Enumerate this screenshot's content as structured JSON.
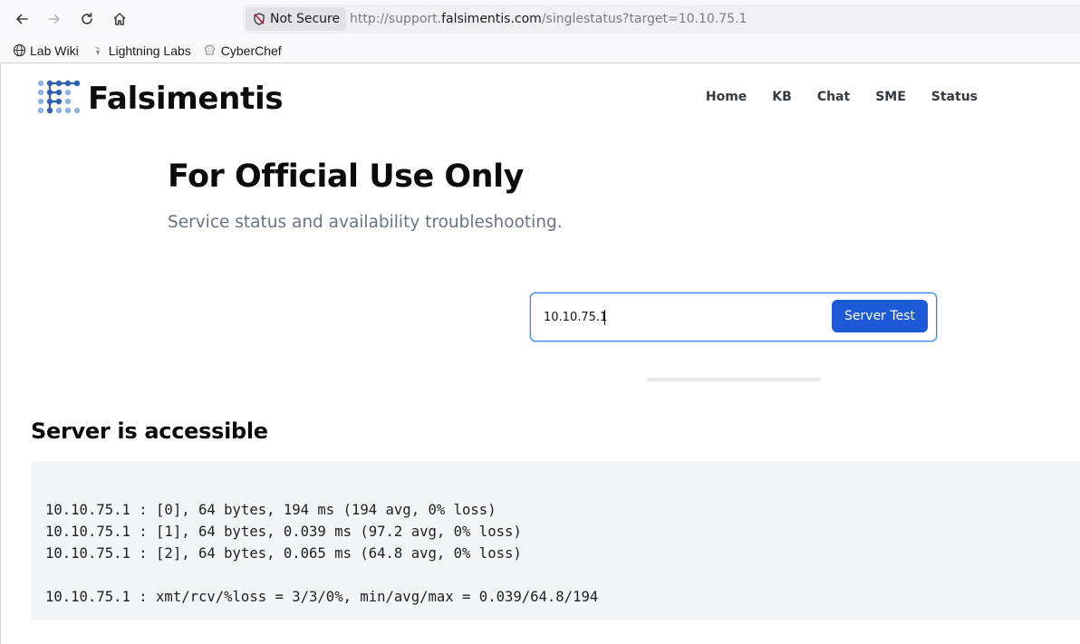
{
  "browser": {
    "security_label": "Not Secure",
    "url_prefix": "http://support.",
    "url_domain": "falsimentis.com",
    "url_path": "/singlestatus?target=10.10.75.1",
    "bookmarks": [
      {
        "label": "Lab Wiki",
        "icon": "globe-icon"
      },
      {
        "label": "Lightning Labs",
        "icon": "lightning-labs-icon"
      },
      {
        "label": "CyberChef",
        "icon": "chef-hat-icon"
      }
    ]
  },
  "site": {
    "brand": "Falsimentis",
    "nav": [
      "Home",
      "KB",
      "Chat",
      "SME",
      "Status"
    ]
  },
  "hero": {
    "title": "For Official Use Only",
    "subtitle": "Service status and availability troubleshooting."
  },
  "search": {
    "value": "10.10.75.1",
    "button_label": "Server Test"
  },
  "result": {
    "title": "Server is accessible",
    "lines": [
      "10.10.75.1 : [0], 64 bytes, 194 ms (194 avg, 0% loss)",
      "10.10.75.1 : [1], 64 bytes, 0.039 ms (97.2 avg, 0% loss)",
      "10.10.75.1 : [2], 64 bytes, 0.065 ms (64.8 avg, 0% loss)"
    ],
    "summary": "10.10.75.1 : xmt/rcv/%loss = 3/3/0%, min/avg/max = 0.039/64.8/194"
  },
  "colors": {
    "accent": "#1d5ad8",
    "focus_ring": "#3b82f6",
    "logo_dark": "#2f5fb0",
    "logo_light": "#8fb3e3"
  }
}
